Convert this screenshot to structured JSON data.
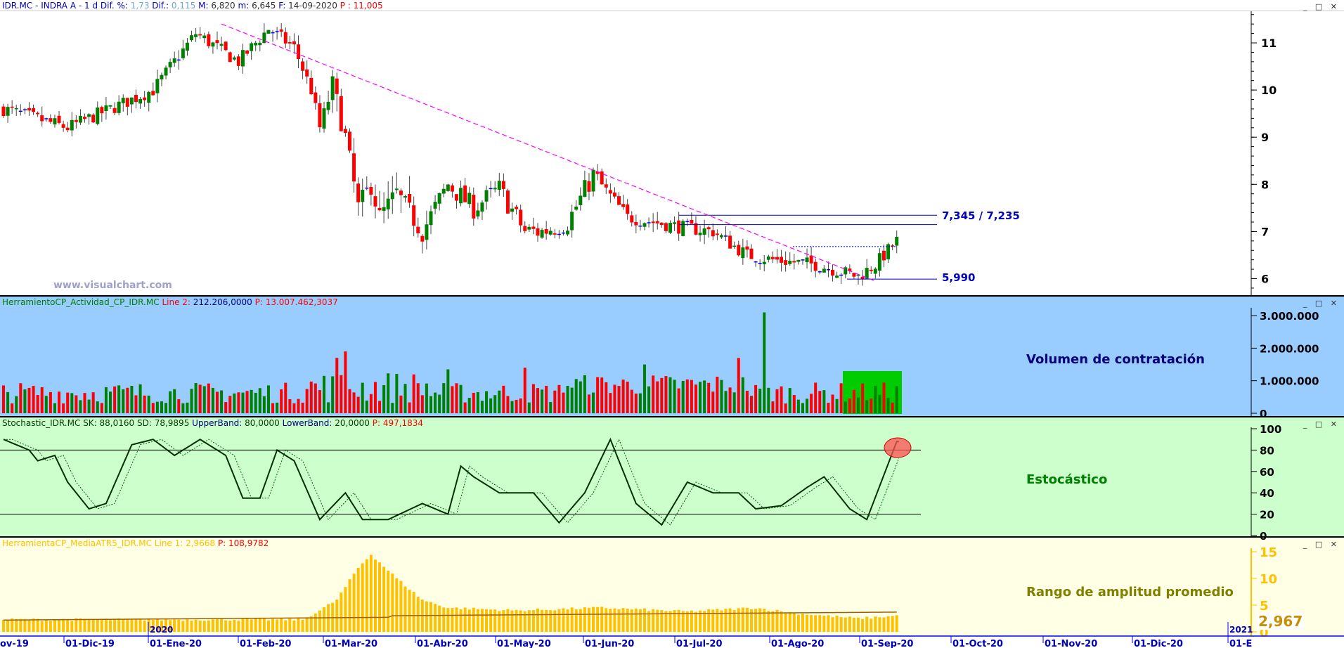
{
  "header": {
    "symbol": "IDR.MC - INDRA A - ",
    "period": "1 d",
    "dif_pct_label": "Dif. %:",
    "dif_pct": "1,73",
    "dif_label": "Dif.:",
    "dif": "0,115",
    "max_label": "M:",
    "max": "6,820",
    "min_label": "m:",
    "min": "6,645",
    "date_label": "F:",
    "date": "14-09-2020",
    "p_label": "P :",
    "p": "11,005"
  },
  "window_controls": "_ □ ✕",
  "watermark": "www.visualchart.com",
  "annotations": {
    "resistance": "7,345 / 7,235",
    "support": "5,990"
  },
  "volume_panel": {
    "name": "HerramientoCP_Actividad_CP_IDR.MC",
    "line_label": "Line 2:",
    "line_value": "212.206,0000",
    "p_label": "P:",
    "p_value": "13.007.462,3037",
    "title": "Volumen de contratación",
    "ticks": [
      "3.000.000",
      "2.000.000",
      "1.000.000",
      "0"
    ]
  },
  "stoch_panel": {
    "name": "Stochastic_IDR.MC",
    "sk": "SK: 88,0160",
    "sd": "SD: 78,9895",
    "upper_label": "UpperBand:",
    "upper": "80,0000",
    "lower_label": "LowerBand:",
    "lower": "20,0000",
    "p": "P: 497,1834",
    "title": "Estocástico",
    "ticks": [
      "100",
      "80",
      "60",
      "40",
      "20",
      "0"
    ]
  },
  "atr_panel": {
    "name": "HerramientaCP_MediaATR5_IDR.MC",
    "line": "Line 1: 2,9668",
    "p": "P: 108,9782",
    "title": "Rango de amplitud promedio",
    "ticks": [
      "15",
      "10",
      "5",
      "0"
    ],
    "last": "2,967"
  },
  "years": [
    "2020",
    "2021"
  ],
  "x_labels": [
    "ov-19",
    "01-Dic-19",
    "01-Ene-20",
    "01-Feb-20",
    "01-Mar-20",
    "01-Abr-20",
    "01-May-20",
    "01-Jun-20",
    "01-Jul-20",
    "01-Ago-20",
    "01-Sep-20",
    "01-Oct-20",
    "01-Nov-20",
    "01-Dic-20",
    "01-E"
  ],
  "colors": {
    "up": "#008000",
    "down": "#ff0000",
    "doji": "#0000ff",
    "trend": "#ff00ff",
    "vol_bg": "#99ccff",
    "stoch_bg": "#ccffcc",
    "atr_bg": "#ffffe6",
    "atr_bar": "#ffc000"
  },
  "chart_data": {
    "type": "candlestick",
    "price_ticks": [
      "11",
      "10",
      "9",
      "8",
      "7",
      "6"
    ],
    "price_keypoints_day_close": [
      [
        0,
        9.6
      ],
      [
        15,
        9.2
      ],
      [
        25,
        9.6
      ],
      [
        35,
        10.0
      ],
      [
        45,
        11.2
      ],
      [
        55,
        10.6
      ],
      [
        62,
        11.3
      ],
      [
        68,
        10.9
      ],
      [
        72,
        10.0
      ],
      [
        74,
        9.2
      ],
      [
        77,
        10.1
      ],
      [
        80,
        9.0
      ],
      [
        83,
        7.5
      ],
      [
        86,
        8.0
      ],
      [
        88,
        7.3
      ],
      [
        92,
        7.8
      ],
      [
        98,
        7.0
      ],
      [
        104,
        8.0
      ],
      [
        110,
        7.5
      ],
      [
        116,
        7.9
      ],
      [
        122,
        7.0
      ],
      [
        126,
        7.0
      ],
      [
        132,
        7.2
      ],
      [
        138,
        8.2
      ],
      [
        146,
        7.3
      ],
      [
        158,
        7.1
      ],
      [
        166,
        7.0
      ],
      [
        174,
        6.5
      ],
      [
        180,
        6.4
      ],
      [
        190,
        6.3
      ],
      [
        200,
        6.05
      ],
      [
        204,
        6.3
      ],
      [
        209,
        6.8
      ]
    ],
    "levels": {
      "resistance_high": 7.345,
      "resistance_low": 7.235,
      "support": 5.99,
      "breakout": 6.68
    },
    "trendline": [
      [
        51,
        11.4
      ],
      [
        204,
        5.95
      ]
    ],
    "stoch_keypoints": [
      [
        0,
        90
      ],
      [
        6,
        80
      ],
      [
        8,
        70
      ],
      [
        12,
        75
      ],
      [
        15,
        50
      ],
      [
        20,
        25
      ],
      [
        24,
        30
      ],
      [
        30,
        85
      ],
      [
        35,
        90
      ],
      [
        40,
        75
      ],
      [
        46,
        90
      ],
      [
        52,
        75
      ],
      [
        56,
        35
      ],
      [
        60,
        35
      ],
      [
        64,
        80
      ],
      [
        68,
        70
      ],
      [
        74,
        15
      ],
      [
        80,
        40
      ],
      [
        84,
        15
      ],
      [
        90,
        15
      ],
      [
        98,
        30
      ],
      [
        104,
        20
      ],
      [
        107,
        65
      ],
      [
        110,
        55
      ],
      [
        116,
        40
      ],
      [
        124,
        40
      ],
      [
        130,
        12
      ],
      [
        136,
        40
      ],
      [
        142,
        90
      ],
      [
        148,
        30
      ],
      [
        154,
        10
      ],
      [
        160,
        50
      ],
      [
        166,
        40
      ],
      [
        172,
        40
      ],
      [
        176,
        25
      ],
      [
        182,
        28
      ],
      [
        188,
        45
      ],
      [
        192,
        55
      ],
      [
        198,
        25
      ],
      [
        202,
        15
      ],
      [
        209,
        88
      ]
    ],
    "atr_keypoints": [
      [
        0,
        2.3
      ],
      [
        70,
        2.3
      ],
      [
        74,
        4
      ],
      [
        78,
        6
      ],
      [
        83,
        12
      ],
      [
        86,
        14.5
      ],
      [
        92,
        10
      ],
      [
        98,
        6
      ],
      [
        104,
        4.5
      ],
      [
        120,
        4
      ],
      [
        140,
        4.5
      ],
      [
        160,
        3.8
      ],
      [
        176,
        4.5
      ],
      [
        185,
        3.5
      ],
      [
        200,
        2.5
      ],
      [
        209,
        3.0
      ]
    ],
    "volume_spikes": [
      [
        80,
        1900000
      ],
      [
        78,
        1700000
      ],
      [
        172,
        1700000
      ],
      [
        178,
        3100000
      ],
      [
        104,
        1350000
      ],
      [
        122,
        1400000
      ],
      [
        150,
        1500000
      ]
    ]
  }
}
